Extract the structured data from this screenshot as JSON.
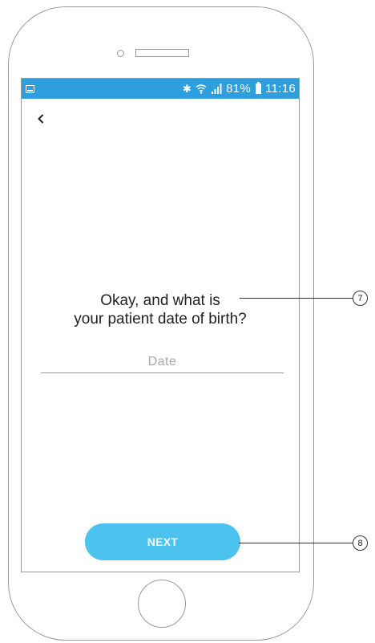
{
  "status_bar": {
    "battery_percent": "81%",
    "time": "11:16",
    "icons": [
      "gallery-icon",
      "bluetooth-icon",
      "wifi-icon",
      "signal-icon",
      "battery-icon"
    ]
  },
  "header": {
    "back_icon": "chevron-left-icon"
  },
  "main": {
    "question_line1": "Okay, and what is",
    "question_line2": "your patient date of birth?",
    "date_placeholder": "Date",
    "next_label": "NEXT"
  },
  "callouts": {
    "question_number": "7",
    "next_number": "8"
  },
  "colors": {
    "status_bar": "#2e9fdc",
    "next_button": "#4cc2ee",
    "outline": "#9a9a9a"
  }
}
